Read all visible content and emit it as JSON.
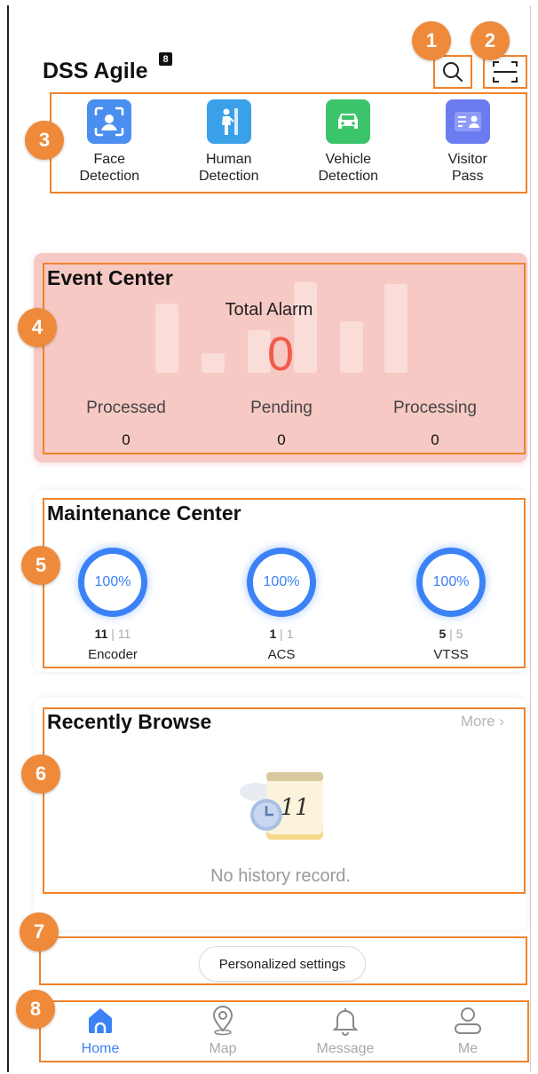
{
  "header": {
    "app_title": "DSS Agile",
    "app_badge": "8",
    "search_icon": "search-icon",
    "scan_icon": "scan-icon"
  },
  "quick_actions": [
    {
      "label": "Face\nDetection",
      "icon": "face-detection-icon",
      "color": "#4a8ff0"
    },
    {
      "label": "Human\nDetection",
      "icon": "human-detection-icon",
      "color": "#3aa0e8"
    },
    {
      "label": "Vehicle\nDetection",
      "icon": "vehicle-detection-icon",
      "color": "#3cc46a"
    },
    {
      "label": "Visitor\nPass",
      "icon": "visitor-pass-icon",
      "color": "#6b7cf0"
    }
  ],
  "event_center": {
    "title": "Event Center",
    "total_label": "Total Alarm",
    "total_value": "0",
    "stats": [
      {
        "label": "Processed",
        "value": "0"
      },
      {
        "label": "Pending",
        "value": "0"
      },
      {
        "label": "Processing",
        "value": "0"
      }
    ]
  },
  "maintenance_center": {
    "title": "Maintenance Center",
    "items": [
      {
        "percent": "100%",
        "online": "11",
        "total": "11",
        "name": "Encoder"
      },
      {
        "percent": "100%",
        "online": "1",
        "total": "1",
        "name": "ACS"
      },
      {
        "percent": "100%",
        "online": "5",
        "total": "5",
        "name": "VTSS"
      }
    ]
  },
  "recently_browse": {
    "title": "Recently Browse",
    "more_label": "More",
    "empty_text": "No history record.",
    "calendar_day": "11"
  },
  "personalized_settings_label": "Personalized settings",
  "tabbar": [
    {
      "label": "Home",
      "icon": "home-icon",
      "active": true
    },
    {
      "label": "Map",
      "icon": "map-pin-icon",
      "active": false
    },
    {
      "label": "Message",
      "icon": "bell-icon",
      "active": false
    },
    {
      "label": "Me",
      "icon": "user-icon",
      "active": false
    }
  ],
  "annotations": [
    "1",
    "2",
    "3",
    "4",
    "5",
    "6",
    "7",
    "8"
  ],
  "colors": {
    "accent": "#3b82f6",
    "highlight": "#f0822b",
    "alarm": "#f25b4b",
    "event_bg": "#f7c9c4"
  }
}
